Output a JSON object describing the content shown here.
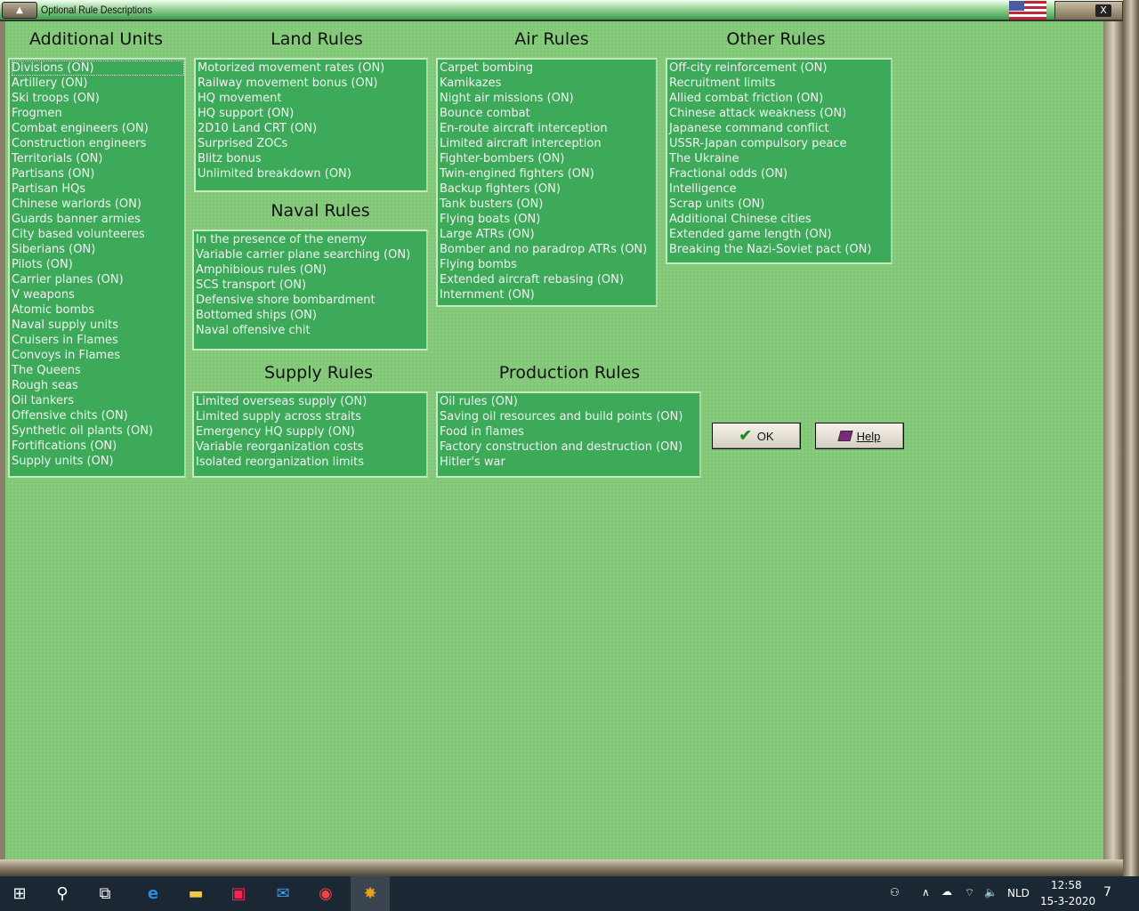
{
  "window": {
    "title": "Optional Rule Descriptions",
    "close": "X",
    "menu": "▲"
  },
  "sections": {
    "additional_units": {
      "title": "Additional Units",
      "items": [
        "Divisions (ON)",
        "Artillery (ON)",
        "Ski troops (ON)",
        "Frogmen",
        "Combat engineers (ON)",
        "Construction engineers",
        "Territorials (ON)",
        "Partisans (ON)",
        "Partisan HQs",
        "Chinese warlords (ON)",
        "Guards banner armies",
        "City based volunteeres",
        "Siberians (ON)",
        "Pilots (ON)",
        "Carrier planes (ON)",
        "V weapons",
        "Atomic bombs",
        "Naval supply units",
        "Cruisers in Flames",
        "Convoys in Flames",
        "The Queens",
        "Rough seas",
        "Oil tankers",
        "Offensive chits (ON)",
        "Synthetic oil plants (ON)",
        "Fortifications (ON)",
        "Supply units (ON)"
      ]
    },
    "land": {
      "title": "Land Rules",
      "items": [
        "Motorized movement rates (ON)",
        "Railway movement bonus (ON)",
        "HQ movement",
        "HQ support (ON)",
        "2D10 Land CRT (ON)",
        "Surprised ZOCs",
        "Blitz bonus",
        "Unlimited breakdown (ON)"
      ]
    },
    "naval": {
      "title": "Naval Rules",
      "items": [
        "In the presence of the enemy",
        "Variable carrier plane searching (ON)",
        "Amphibious rules (ON)",
        "SCS transport (ON)",
        "Defensive shore bombardment",
        "Bottomed ships (ON)",
        "Naval offensive chit"
      ]
    },
    "air": {
      "title": "Air Rules",
      "items": [
        "Carpet bombing",
        "Kamikazes",
        "Night air missions (ON)",
        "Bounce combat",
        "En-route aircraft interception",
        "Limited aircraft interception",
        "Fighter-bombers (ON)",
        "Twin-engined fighters (ON)",
        "Backup fighters (ON)",
        "Tank busters (ON)",
        "Flying boats (ON)",
        "Large ATRs (ON)",
        "Bomber and no paradrop ATRs (ON)",
        "Flying bombs",
        "Extended aircraft rebasing (ON)",
        "Internment (ON)"
      ]
    },
    "other": {
      "title": "Other Rules",
      "items": [
        "Off-city reinforcement (ON)",
        "Recruitment limits",
        "Allied combat friction (ON)",
        "Chinese attack weakness (ON)",
        "Japanese command conflict",
        "USSR-Japan compulsory peace",
        "The Ukraine",
        "Fractional odds (ON)",
        "Intelligence",
        "Scrap units (ON)",
        "Additional Chinese cities",
        "Extended game length (ON)",
        "Breaking the Nazi-Soviet pact (ON)"
      ]
    },
    "supply": {
      "title": "Supply Rules",
      "items": [
        "Limited overseas supply (ON)",
        "Limited supply across straits",
        "Emergency HQ supply (ON)",
        "Variable reorganization costs",
        "Isolated reorganization limits"
      ]
    },
    "production": {
      "title": "Production Rules",
      "items": [
        "Oil rules (ON)",
        "Saving oil resources and build points (ON)",
        "Food in flames",
        "Factory construction and destruction (ON)",
        "Hitler's war"
      ]
    }
  },
  "buttons": {
    "ok": "OK",
    "help": "Help"
  },
  "taskbar": {
    "lang": "NLD",
    "time": "12:58",
    "date": "15-3-2020",
    "notifications": "7"
  }
}
